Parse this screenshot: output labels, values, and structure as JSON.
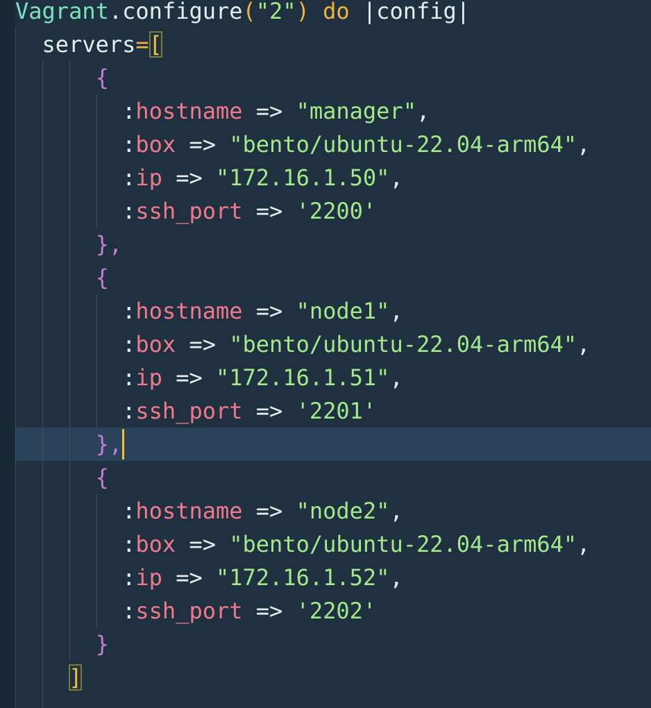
{
  "code": {
    "line1": {
      "const": "Vagrant",
      "dot": ".",
      "method": "configure",
      "lparen": "(",
      "str": "\"2\"",
      "rparen": ")",
      "kw": "do",
      "block": "|config|"
    },
    "line2": {
      "name": "servers",
      "eq": "=",
      "bracket": "["
    },
    "open_brace": "{",
    "close_brace_comma": "},",
    "close_brace": "}",
    "close_bracket": "]",
    "colon": ":",
    "arrow": "=>",
    "comma": ",",
    "keys": {
      "hostname": "hostname",
      "box": "box",
      "ip": "ip",
      "ssh_port": "ssh_port"
    },
    "servers": [
      {
        "hostname": "\"manager\"",
        "box": "\"bento/ubuntu-22.04-arm64\"",
        "ip": "\"172.16.1.50\"",
        "ssh_port": "'2200'"
      },
      {
        "hostname": "\"node1\"",
        "box": "\"bento/ubuntu-22.04-arm64\"",
        "ip": "\"172.16.1.51\"",
        "ssh_port": "'2201'"
      },
      {
        "hostname": "\"node2\"",
        "box": "\"bento/ubuntu-22.04-arm64\"",
        "ip": "\"172.16.1.52\"",
        "ssh_port": "'2202'"
      }
    ]
  },
  "colors": {
    "background": "#1f3141",
    "current_line": "#2a435a",
    "string": "#a3e98a",
    "symbol": "#f07a8c",
    "brace": "#c77dd7",
    "keyword": "#f0b43c",
    "constant": "#7ce3bd",
    "cursor": "#f2c230"
  }
}
